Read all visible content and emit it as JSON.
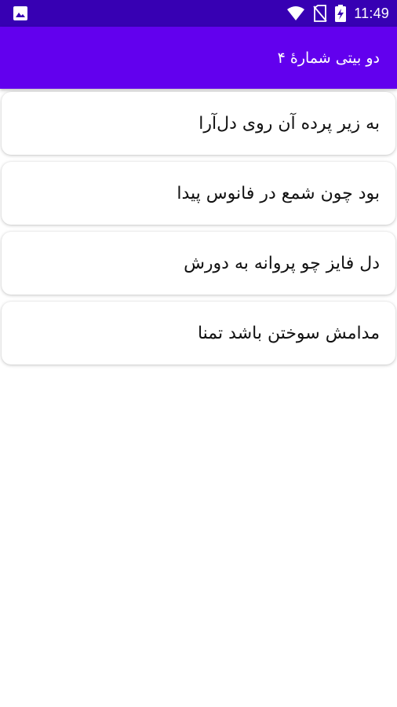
{
  "status_bar": {
    "time": "11:49",
    "icons": [
      "image-icon",
      "wifi-icon",
      "no-sim-icon",
      "battery-charging-icon"
    ]
  },
  "app_bar": {
    "title": "دو بیتی شمارهٔ ۴"
  },
  "verses": [
    {
      "text": "به زیر پرده آن روی دل‌آرا"
    },
    {
      "text": "بود چون شمع در فانوس پیدا"
    },
    {
      "text": "دل فایز چو پروانه به دورش"
    },
    {
      "text": "مدامش سوختن باشد تمنا"
    }
  ],
  "colors": {
    "status_bar": "#3700b3",
    "app_bar": "#6200ee",
    "card_bg": "#ffffff"
  }
}
